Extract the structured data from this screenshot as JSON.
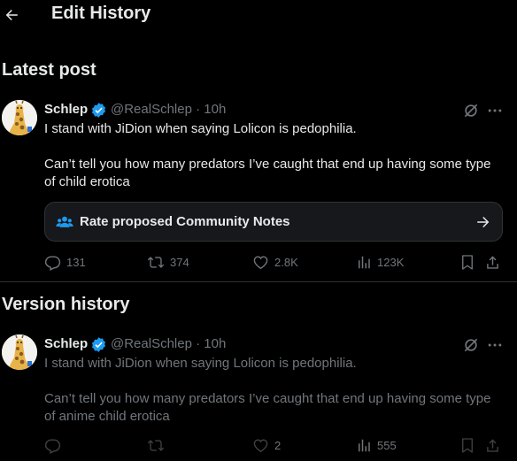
{
  "header": {
    "title": "Edit History"
  },
  "latest": {
    "section_title": "Latest post",
    "author_name": "Schlep",
    "handle_time": "@RealSchlep · 10h",
    "text": "I stand with JiDion when saying Lolicon is pedophilia.\n\nCan’t tell you how many predators I’ve caught that end up having some type of child erotica",
    "community_notes_label": "Rate proposed Community Notes",
    "actions": {
      "replies": "131",
      "reposts": "374",
      "likes": "2.8K",
      "views": "123K"
    }
  },
  "history": {
    "section_title": "Version history",
    "author_name": "Schlep",
    "handle_time": "@RealSchlep · 10h",
    "text": "I stand with JiDion when saying Lolicon is pedophilia.\n\nCan’t tell you how many predators I’ve caught that end up having some type of anime child erotica",
    "actions": {
      "replies": "",
      "reposts": "",
      "likes": "2",
      "views": "555"
    }
  },
  "colors": {
    "background": "#000000",
    "text": "#e7e9ea",
    "muted": "#71767b",
    "verified": "#1d9bf0",
    "border": "#2f3336"
  },
  "icons": [
    "back-arrow-icon",
    "verified-badge-icon",
    "grok-icon",
    "more-icon",
    "community-notes-icon",
    "arrow-right-icon",
    "reply-icon",
    "repost-icon",
    "like-icon",
    "views-icon",
    "bookmark-icon",
    "share-icon"
  ]
}
